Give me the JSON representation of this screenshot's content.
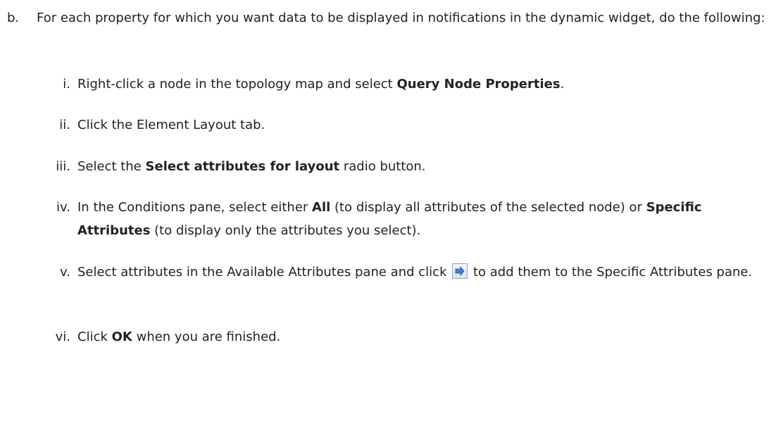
{
  "step_b": {
    "marker": "b.",
    "text": "For each property for which you want data to be displayed in notifications in the dynamic widget, do the following:"
  },
  "steps": [
    {
      "marker": "i.",
      "parts": [
        "Right-click a node in the topology map and select ",
        "Query Node Properties",
        "."
      ]
    },
    {
      "marker": "ii.",
      "parts": [
        "Click the Element Layout tab."
      ]
    },
    {
      "marker": "iii.",
      "parts": [
        "Select the ",
        "Select attributes for layout",
        " radio button."
      ]
    },
    {
      "marker": "iv.",
      "parts": [
        "In the Conditions pane, select either ",
        "All",
        " (to display all attributes of the selected node) or ",
        "Specific Attributes",
        " (to display only the attributes you select)."
      ]
    },
    {
      "marker": "v.",
      "parts": [
        "Select attributes in the Available Attributes pane and click ",
        " to add them to the Specific Attributes pane."
      ],
      "icon": "add-arrow-icon"
    },
    {
      "marker": "vi.",
      "parts": [
        "Click ",
        "OK",
        " when you are finished."
      ]
    }
  ]
}
